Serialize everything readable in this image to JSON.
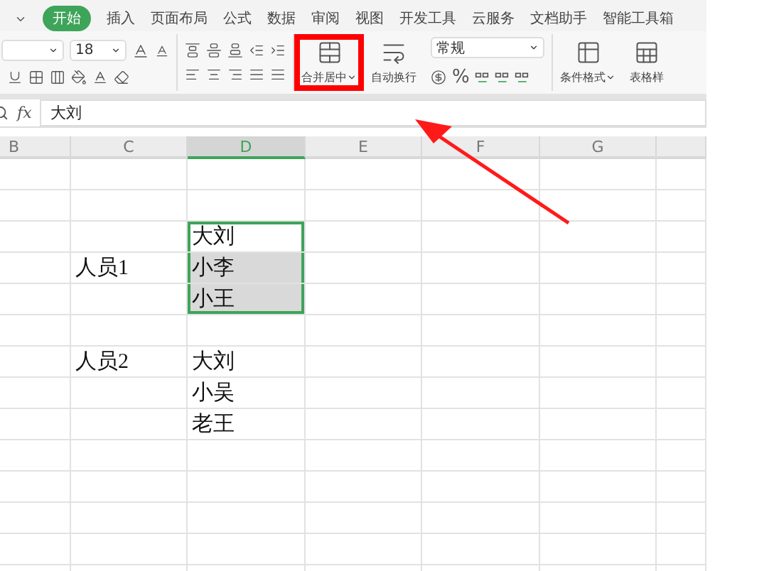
{
  "tabs": [
    {
      "label": "开始",
      "selected": true
    },
    {
      "label": "插入",
      "selected": false
    },
    {
      "label": "页面布局",
      "selected": false
    },
    {
      "label": "公式",
      "selected": false
    },
    {
      "label": "数据",
      "selected": false
    },
    {
      "label": "审阅",
      "selected": false
    },
    {
      "label": "视图",
      "selected": false
    },
    {
      "label": "开发工具",
      "selected": false
    },
    {
      "label": "云服务",
      "selected": false
    },
    {
      "label": "文档助手",
      "selected": false
    },
    {
      "label": "智能工具箱",
      "selected": false
    }
  ],
  "ribbon": {
    "font_size": "18",
    "number_format": "常规",
    "percent": "%",
    "buttons": [
      {
        "kind": "merge",
        "label": "合并居中",
        "dropdown": true,
        "highlighted": true
      },
      {
        "kind": "wrap",
        "label": "自动换行",
        "dropdown": false,
        "highlighted": false
      },
      {
        "kind": "conditional",
        "label": "条件格式",
        "dropdown": true,
        "highlighted": false
      },
      {
        "kind": "table",
        "label": "表格样",
        "dropdown": false,
        "highlighted": false
      }
    ]
  },
  "formula_bar": {
    "label": "fx",
    "value": "大刘"
  },
  "columns": [
    {
      "label": "B",
      "selected": false
    },
    {
      "label": "C",
      "selected": false
    },
    {
      "label": "D",
      "selected": true
    },
    {
      "label": "E",
      "selected": false
    },
    {
      "label": "F",
      "selected": false
    },
    {
      "label": "G",
      "selected": false
    }
  ],
  "rows": [
    {},
    {},
    {
      "d": {
        "text": "大刘",
        "selected": true,
        "active": true
      }
    },
    {
      "c": "人员1",
      "d": {
        "text": "小李",
        "selected": true,
        "active": false
      }
    },
    {
      "d": {
        "text": "小王",
        "selected": true,
        "active": false
      }
    },
    {},
    {
      "c": "人员2",
      "d": {
        "text": "大刘",
        "selected": false,
        "active": false
      }
    },
    {
      "d": {
        "text": "小吴",
        "selected": false,
        "active": false
      }
    },
    {
      "d": {
        "text": "老王",
        "selected": false,
        "active": false
      }
    },
    {},
    {},
    {},
    {},
    {}
  ]
}
